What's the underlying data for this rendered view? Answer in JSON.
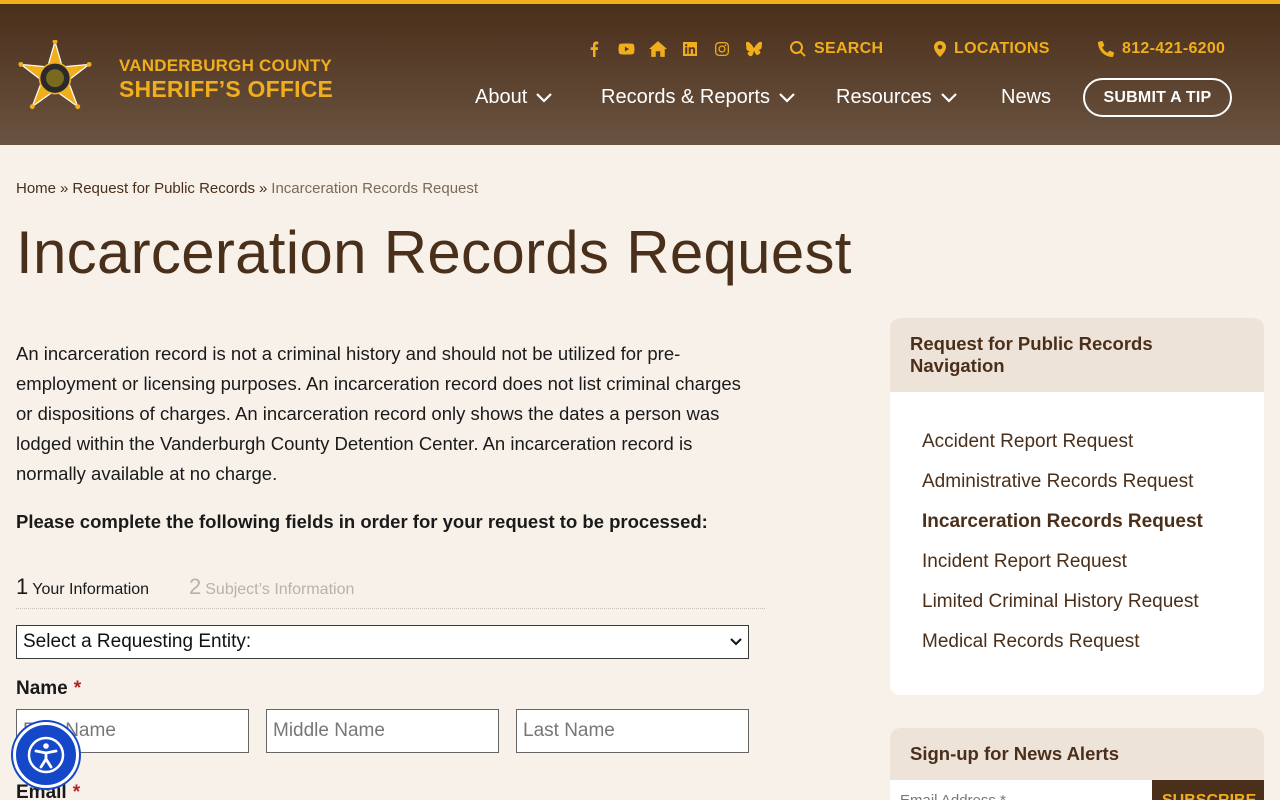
{
  "header": {
    "brand_line1": "VANDERBURGH COUNTY",
    "brand_line2": "SHERIFF’S OFFICE",
    "social": [
      {
        "name": "facebook-icon"
      },
      {
        "name": "youtube-icon"
      },
      {
        "name": "home-icon"
      },
      {
        "name": "linkedin-icon"
      },
      {
        "name": "instagram-icon"
      },
      {
        "name": "bluesky-icon"
      }
    ],
    "search_label": "SEARCH",
    "locations_label": "LOCATIONS",
    "phone_label": "812-421-6200",
    "nav": {
      "about": "About",
      "records": "Records & Reports",
      "resources": "Resources",
      "news": "News"
    },
    "tip_label": "SUBMIT A TIP",
    "accent_color": "#f1ae1c",
    "brand_color": "#4a2f1a"
  },
  "breadcrumb": {
    "home": "Home",
    "sep": "»",
    "parent": "Request for Public Records",
    "current": "Incarceration Records Request"
  },
  "page": {
    "title": "Incarceration Records Request",
    "intro": "An incarceration record is not a criminal history and should not be utilized for pre-employment or licensing purposes. An incarceration record does not list criminal charges or dispositions of charges. An incarceration record only shows the dates a person was lodged within the Vanderburgh County Detention Center. An incarceration record is normally available at no charge.",
    "instruction": "Please complete the following fields in order for your request to be processed:"
  },
  "form": {
    "steps": [
      {
        "num": "1",
        "label": "Your Information"
      },
      {
        "num": "2",
        "label": "Subject’s Information"
      }
    ],
    "entity_select": "Select a Requesting Entity:",
    "name_label": "Name",
    "required_mark": "*",
    "first_placeholder": "First Name",
    "middle_placeholder": "Middle Name",
    "last_placeholder": "Last Name",
    "email_label": "Email"
  },
  "sidebar": {
    "heading": "Request for Public Records Navigation",
    "items": [
      {
        "label": "Accident Report Request"
      },
      {
        "label": "Administrative Records Request"
      },
      {
        "label": "Incarceration Records Request"
      },
      {
        "label": "Incident Report Request"
      },
      {
        "label": "Limited Criminal History Request"
      },
      {
        "label": "Medical Records Request"
      }
    ],
    "news_heading": "Sign-up for News Alerts",
    "news_placeholder": "Email Address *",
    "news_button": "SUBSCRIBE"
  }
}
